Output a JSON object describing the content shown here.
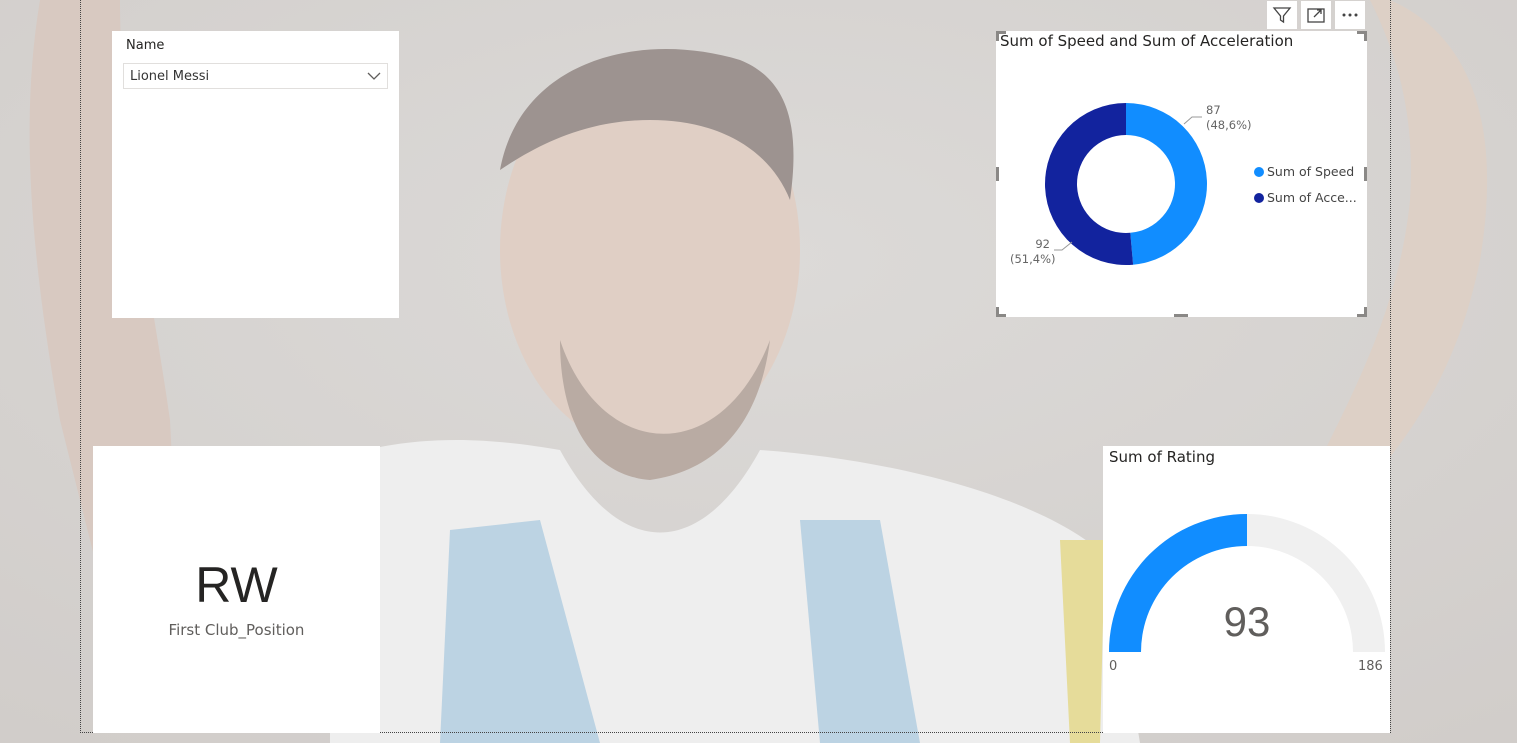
{
  "colors": {
    "speed": "#118dff",
    "acceleration": "#12239e",
    "gauge_fill": "#118dff",
    "gauge_track": "#f0f0f0"
  },
  "slicer": {
    "title": "Name",
    "selected": "Lionel Messi",
    "chevron_icon": "chevron-down-icon"
  },
  "donut": {
    "title": "Sum of Speed and Sum of Acceleration",
    "labels": {
      "speed_value": "87",
      "speed_pct": "(48,6%)",
      "accel_value": "92",
      "accel_pct": "(51,4%)"
    },
    "legend": {
      "speed": "Sum of Speed",
      "acceleration": "Sum of Acce..."
    }
  },
  "toolbar": {
    "filter_icon": "filter-icon",
    "focus_icon": "focus-mode-icon",
    "more_icon": "more-options-icon"
  },
  "kpi": {
    "value": "RW",
    "label": "First Club_Position"
  },
  "gauge": {
    "title": "Sum of Rating",
    "value": "93",
    "min": "0",
    "max": "186"
  },
  "background_image": "player-photo",
  "chart_data": [
    {
      "type": "pie",
      "title": "Sum of Speed and Sum of Acceleration",
      "categories": [
        "Sum of Speed",
        "Sum of Acceleration"
      ],
      "values": [
        87,
        92
      ],
      "percentages": [
        "48,6%",
        "51,4%"
      ]
    },
    {
      "type": "gauge",
      "title": "Sum of Rating",
      "value": 93,
      "min": 0,
      "max": 186
    }
  ]
}
